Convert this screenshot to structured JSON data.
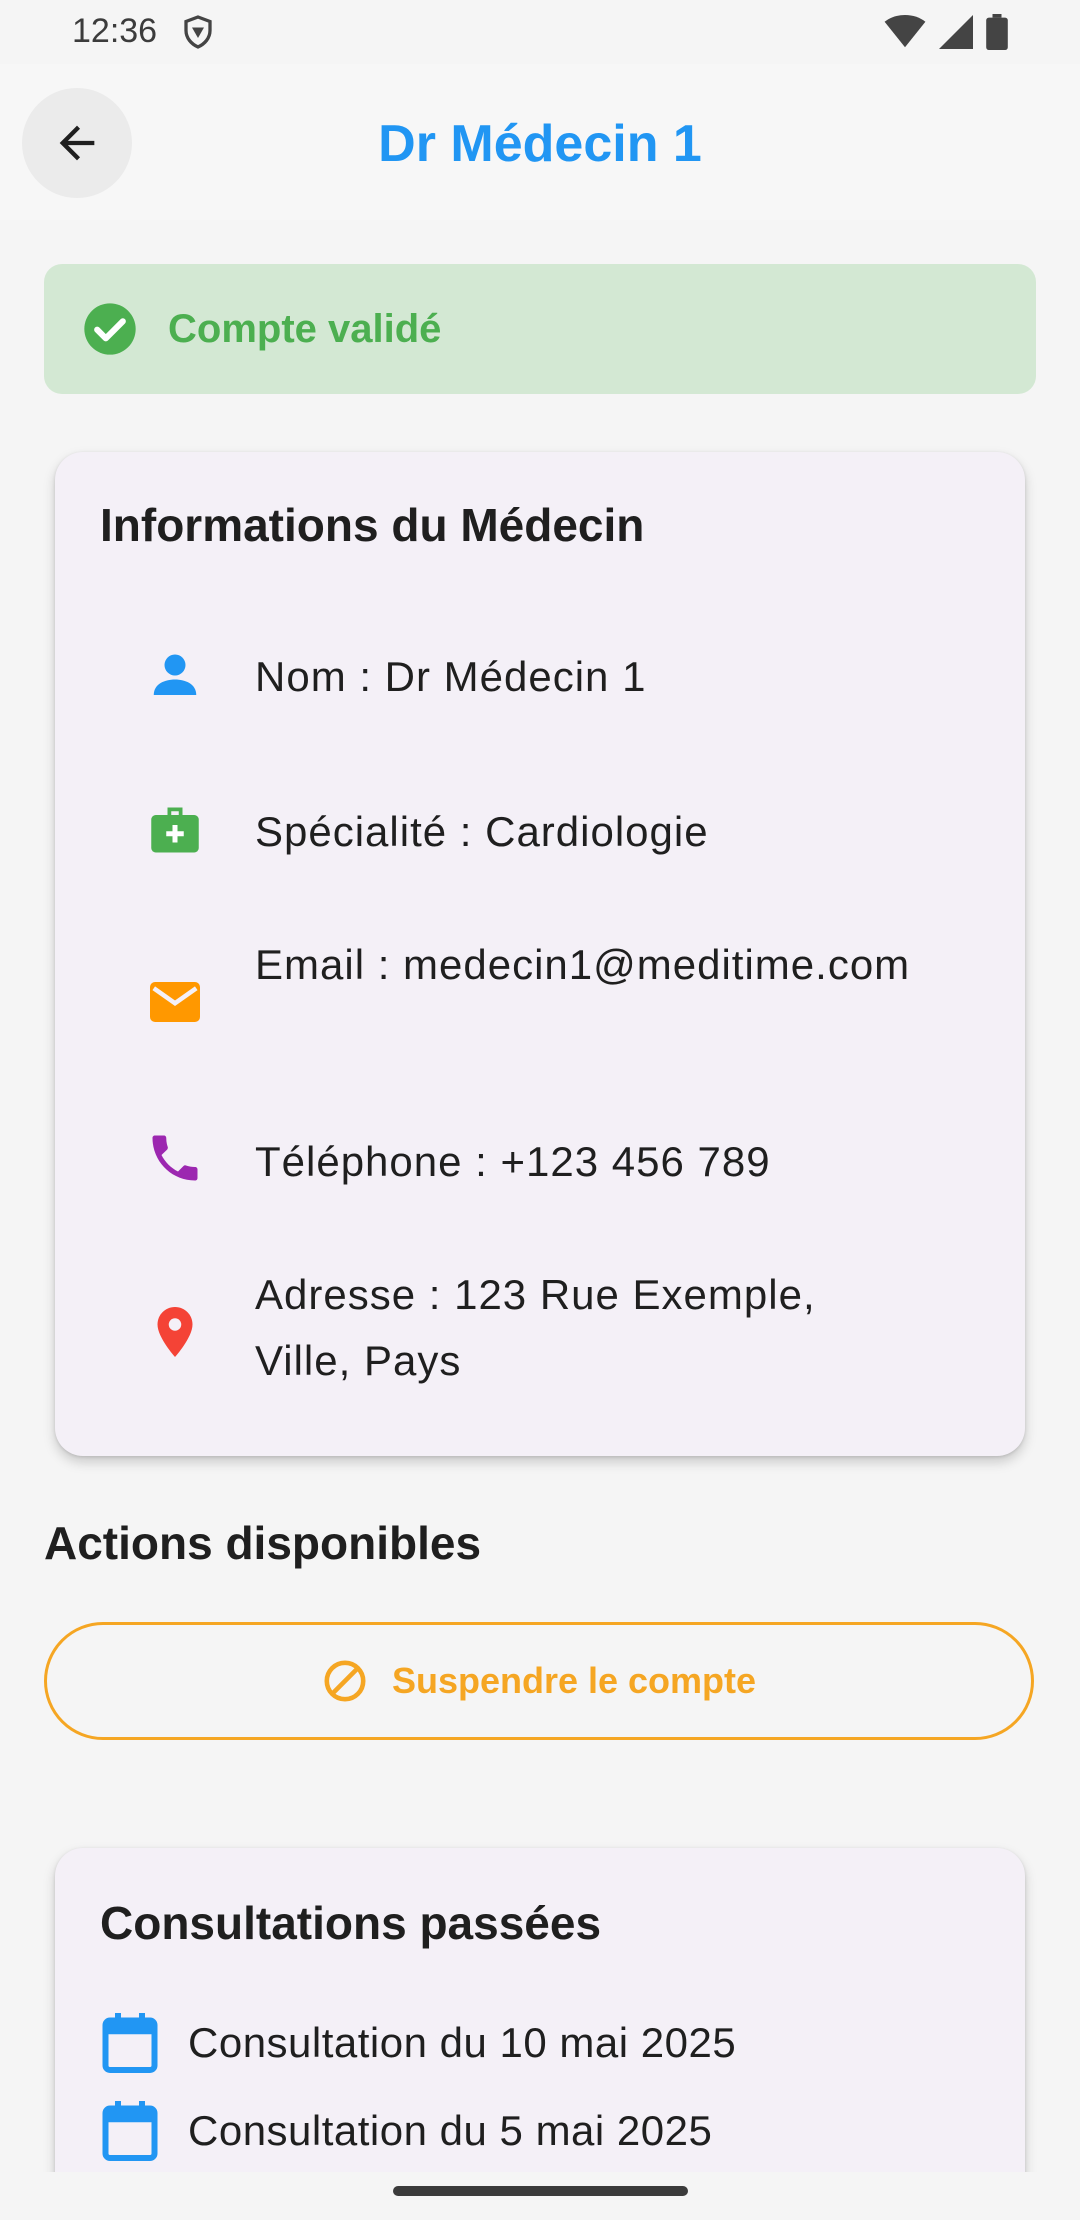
{
  "status_bar": {
    "time": "12:36"
  },
  "app_bar": {
    "title": "Dr Médecin 1"
  },
  "banner": {
    "text": "Compte validé",
    "color": "#4caf50"
  },
  "info_card": {
    "title": "Informations du Médecin",
    "rows": [
      {
        "icon": "person-icon",
        "color": "#2196f3",
        "text": "Nom : Dr Médecin 1"
      },
      {
        "icon": "medical-bag-icon",
        "color": "#4caf50",
        "text": "Spécialité : Cardiologie"
      },
      {
        "icon": "email-icon",
        "color": "#ff9800",
        "text": "Email : medecin1@meditime.com"
      },
      {
        "icon": "phone-icon",
        "color": "#9c27b0",
        "text": "Téléphone : +123 456 789"
      },
      {
        "icon": "location-pin-icon",
        "color": "#f44336",
        "text": "Adresse : 123 Rue Exemple, Ville, Pays"
      }
    ]
  },
  "actions": {
    "title": "Actions disponibles",
    "suspend_label": "Suspendre le compte",
    "suspend_color": "#f5a623"
  },
  "consultations": {
    "title": "Consultations passées",
    "items": [
      {
        "icon": "calendar-icon",
        "text": "Consultation du 10 mai 2025"
      },
      {
        "icon": "calendar-icon",
        "text": "Consultation du 5 mai 2025"
      }
    ]
  },
  "accent_color": "#2196f3"
}
